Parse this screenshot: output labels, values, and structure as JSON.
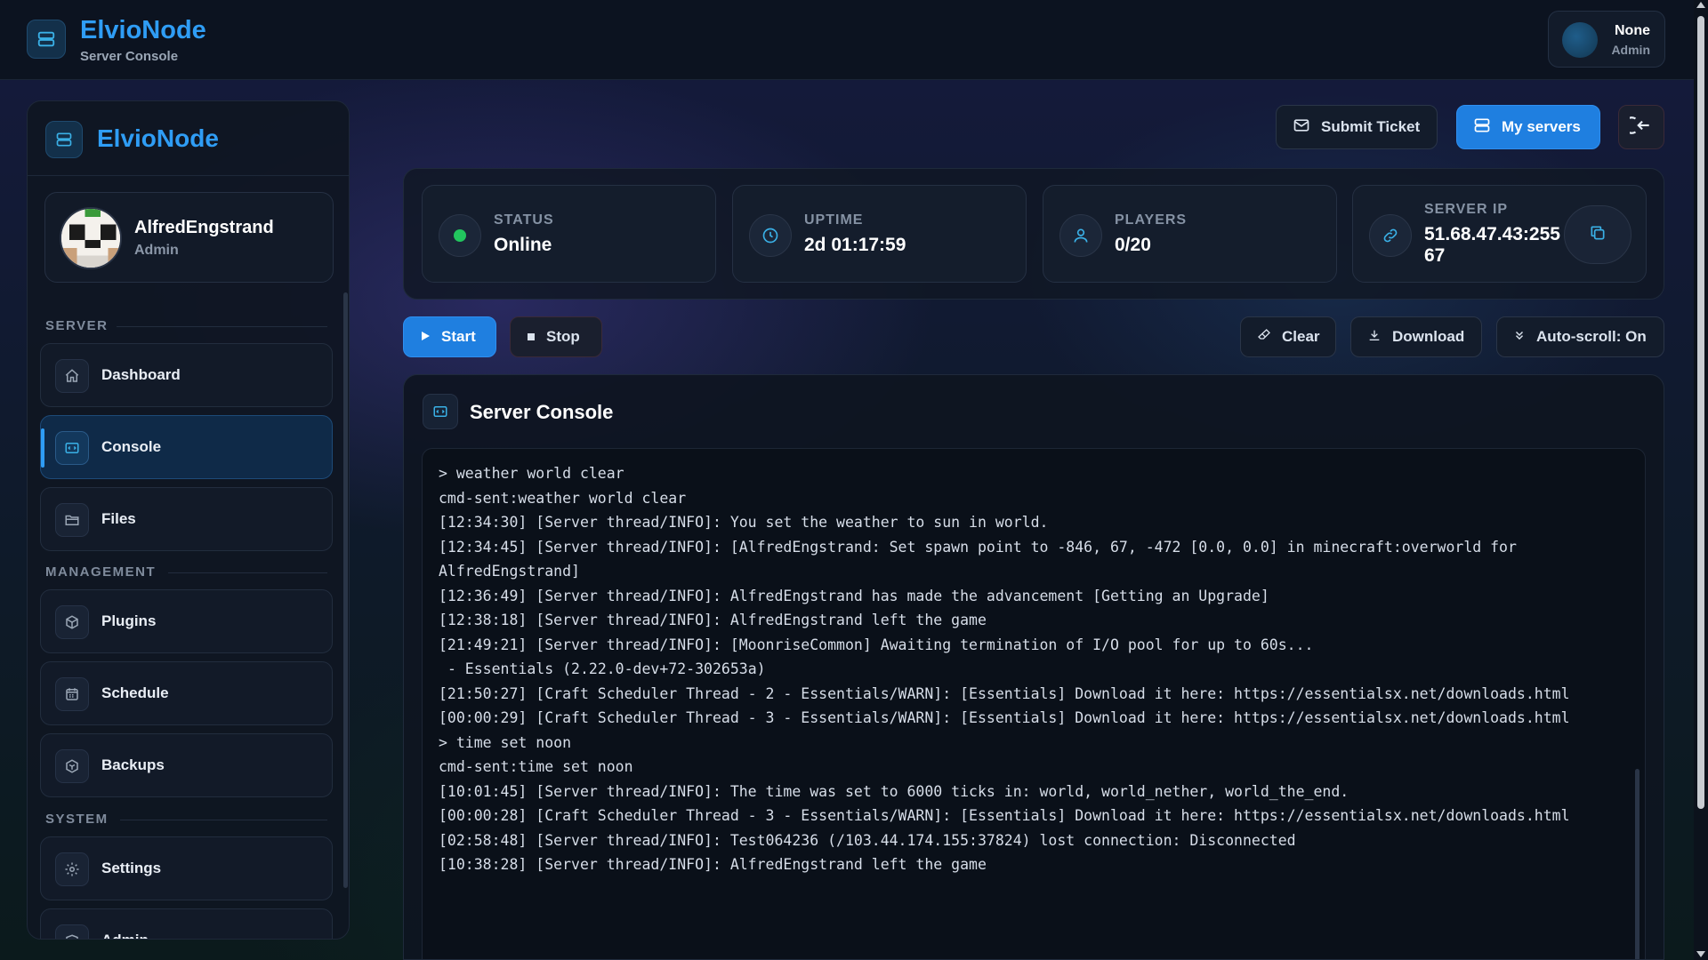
{
  "app": {
    "title": "ElvioNode",
    "subtitle": "Server Console"
  },
  "account": {
    "name": "None",
    "role": "Admin"
  },
  "sidebar": {
    "brand": "ElvioNode",
    "profile": {
      "name": "AlfredEngstrand",
      "role": "Admin"
    },
    "sections": {
      "server": "SERVER",
      "management": "MANAGEMENT",
      "system": "SYSTEM"
    },
    "items": [
      {
        "label": "Dashboard",
        "icon": "home-icon",
        "active": false
      },
      {
        "label": "Console",
        "icon": "terminal-icon",
        "active": true
      },
      {
        "label": "Files",
        "icon": "folder-icon",
        "active": false
      },
      {
        "label": "Plugins",
        "icon": "box-icon",
        "active": false
      },
      {
        "label": "Schedule",
        "icon": "calendar-icon",
        "active": false
      },
      {
        "label": "Backups",
        "icon": "archive-icon",
        "active": false
      },
      {
        "label": "Settings",
        "icon": "gear-icon",
        "active": false
      },
      {
        "label": "Admin",
        "icon": "shield-icon",
        "active": false
      }
    ]
  },
  "header_actions": {
    "submit_ticket": "Submit Ticket",
    "my_servers": "My servers"
  },
  "stats": {
    "status": {
      "label": "STATUS",
      "value": "Online"
    },
    "uptime": {
      "label": "UPTIME",
      "value": "2d 01:17:59"
    },
    "players": {
      "label": "PLAYERS",
      "value": "0/20"
    },
    "server_ip": {
      "label": "SERVER IP",
      "value": "51.68.47.43:25567"
    }
  },
  "console_actions": {
    "start": "Start",
    "stop": "Stop",
    "clear": "Clear",
    "download": "Download",
    "autoscroll": "Auto-scroll: On"
  },
  "console": {
    "title": "Server Console",
    "lines": [
      "> weather world clear",
      "cmd-sent:weather world clear",
      "[12:34:30] [Server thread/INFO]: You set the weather to sun in world.",
      "[12:34:45] [Server thread/INFO]: [AlfredEngstrand: Set spawn point to -846, 67, -472 [0.0, 0.0] in minecraft:overworld for AlfredEngstrand]",
      "[12:36:49] [Server thread/INFO]: AlfredEngstrand has made the advancement [Getting an Upgrade]",
      "[12:38:18] [Server thread/INFO]: AlfredEngstrand left the game",
      "[21:49:21] [Server thread/INFO]: [MoonriseCommon] Awaiting termination of I/O pool for up to 60s...",
      " - Essentials (2.22.0-dev+72-302653a)",
      "[21:50:27] [Craft Scheduler Thread - 2 - Essentials/WARN]: [Essentials] Download it here: https://essentialsx.net/downloads.html",
      "[00:00:29] [Craft Scheduler Thread - 3 - Essentials/WARN]: [Essentials] Download it here: https://essentialsx.net/downloads.html",
      "> time set noon",
      "cmd-sent:time set noon",
      "[10:01:45] [Server thread/INFO]: The time was set to 6000 ticks in: world, world_nether, world_the_end.",
      "[00:00:28] [Craft Scheduler Thread - 3 - Essentials/WARN]: [Essentials] Download it here: https://essentialsx.net/downloads.html",
      "[02:58:48] [Server thread/INFO]: Test064236 (/103.44.174.155:37824) lost connection: Disconnected",
      "[10:38:28] [Server thread/INFO]: AlfredEngstrand left the game"
    ]
  },
  "colors": {
    "accent": "#2f9df5",
    "button_primary": "#1f7fe0",
    "status_online": "#22c55e",
    "icon_cyan": "#3ab0e6"
  }
}
